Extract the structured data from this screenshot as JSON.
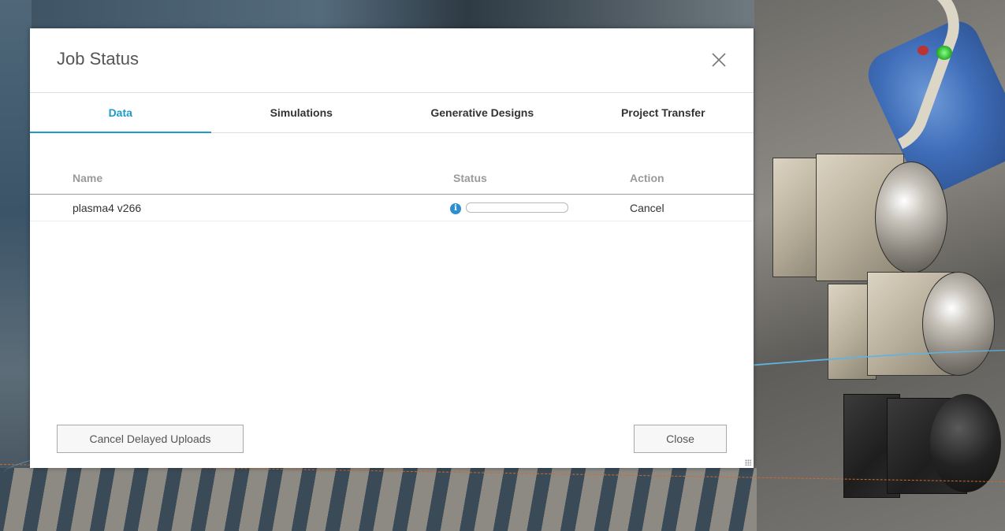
{
  "dialog": {
    "title": "Job Status"
  },
  "tabs": [
    {
      "label": "Data",
      "active": true
    },
    {
      "label": "Simulations",
      "active": false
    },
    {
      "label": "Generative Designs",
      "active": false
    },
    {
      "label": "Project Transfer",
      "active": false
    }
  ],
  "table": {
    "columns": {
      "name": "Name",
      "status": "Status",
      "action": "Action"
    },
    "rows": [
      {
        "name": "plasma4 v266",
        "status_icon": "info-icon",
        "progress": 0,
        "action": "Cancel"
      }
    ]
  },
  "footer": {
    "cancel_delayed_uploads": "Cancel Delayed Uploads",
    "close": "Close"
  },
  "colors": {
    "accent": "#1e9bc7",
    "info_icon": "#2b8fd0"
  }
}
